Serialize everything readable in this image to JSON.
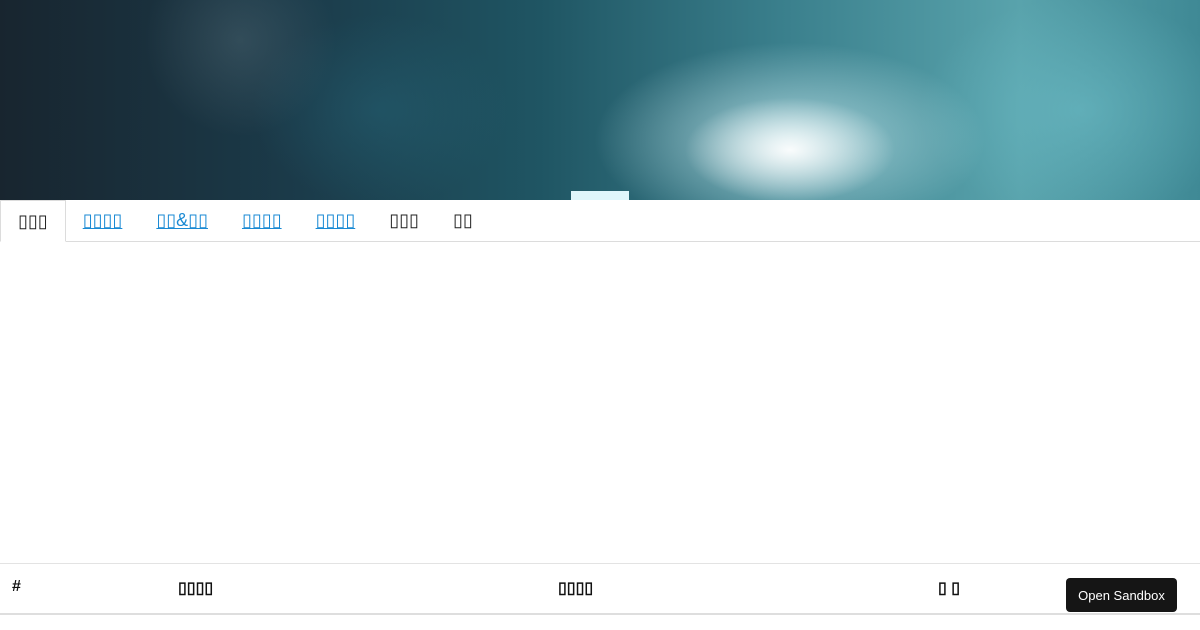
{
  "tabs": [
    {
      "label": "▯▯▯",
      "active": true
    },
    {
      "label": "▯▯▯▯",
      "active": false
    },
    {
      "label": "▯▯&▯▯",
      "active": false
    },
    {
      "label": "▯▯▯▯",
      "active": false
    },
    {
      "label": "▯▯▯▯",
      "active": false
    },
    {
      "label": "▯▯▯",
      "active": false
    },
    {
      "label": "▯▯",
      "active": false
    }
  ],
  "table": {
    "headers": [
      "#",
      "▯▯▯▯",
      "▯▯▯▯",
      "▯ ▯"
    ]
  },
  "sandbox_button": {
    "label": "Open Sandbox"
  },
  "colors": {
    "link": "#1a8ad4",
    "button_bg": "#151515"
  }
}
